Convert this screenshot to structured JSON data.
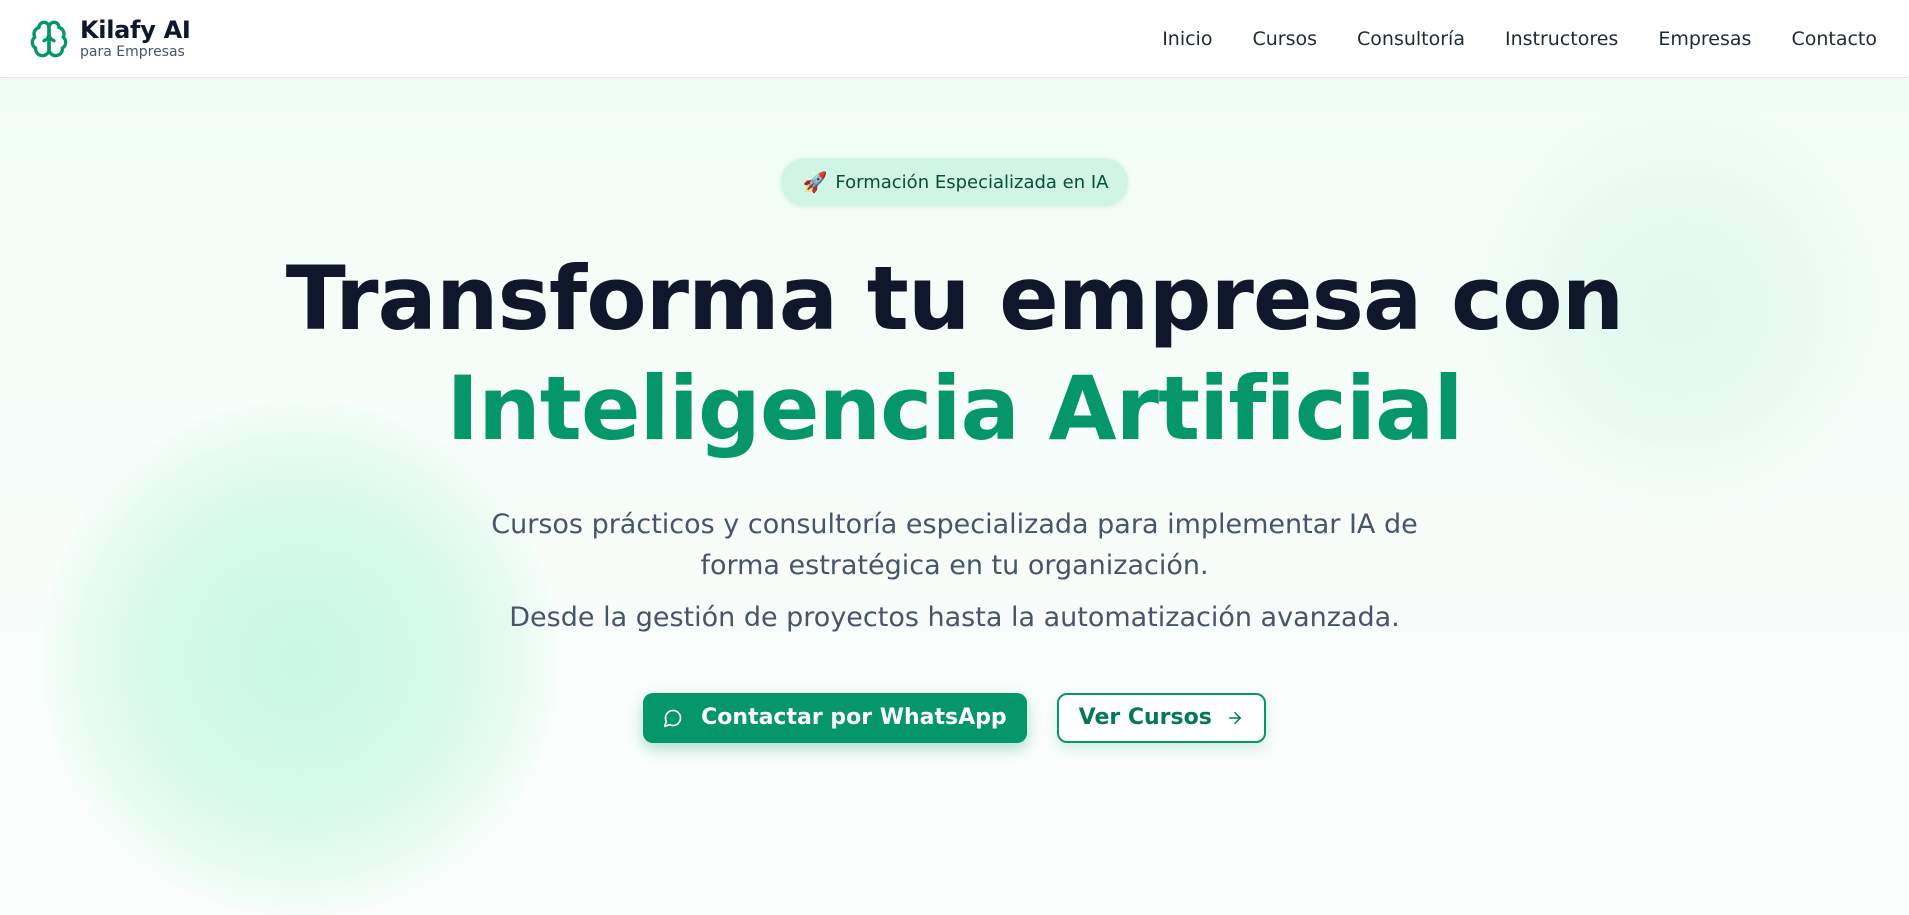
{
  "brand": {
    "name": "Kilafy AI",
    "subtitle": "para Empresas",
    "logo_icon": "brain-icon",
    "accent_color": "#059669"
  },
  "nav": {
    "items": [
      {
        "label": "Inicio"
      },
      {
        "label": "Cursos"
      },
      {
        "label": "Consultoría"
      },
      {
        "label": "Instructores"
      },
      {
        "label": "Empresas"
      },
      {
        "label": "Contacto"
      }
    ]
  },
  "hero": {
    "badge": {
      "icon": "rocket-icon",
      "emoji": "🚀",
      "label": "Formación Especializada en IA"
    },
    "title_line1": "Transforma tu empresa con",
    "title_line2": "Inteligencia Artificial",
    "subtitle": "Cursos prácticos y consultoría especializada para implementar IA de forma estratégica en tu organización.",
    "subtitle_2": "Desde la gestión de proyectos hasta la automatización avanzada.",
    "primary_button": {
      "label": "Contactar por WhatsApp",
      "icon": "chat-bubble-icon"
    },
    "secondary_button": {
      "label": "Ver Cursos",
      "icon": "arrow-right-icon"
    }
  },
  "colors": {
    "primary": "#059669",
    "heading": "#0f172a",
    "body_text": "#475569",
    "badge_bg": "#d1f5e5"
  }
}
